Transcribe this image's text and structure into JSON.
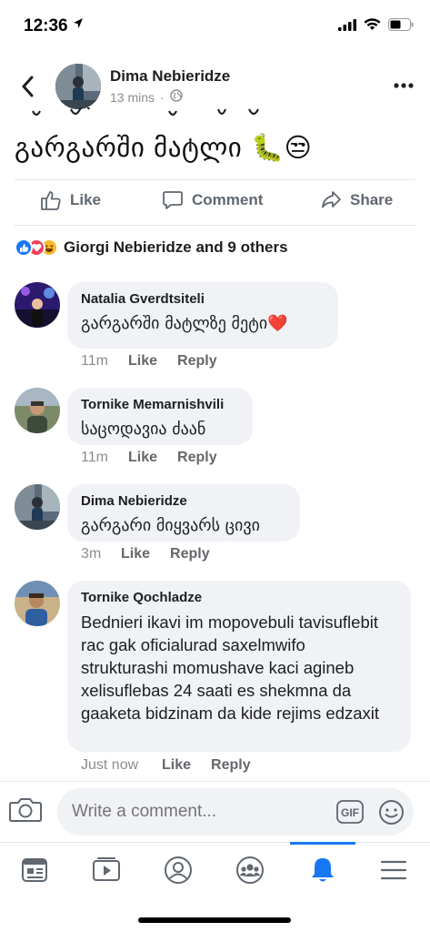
{
  "status_bar": {
    "time": "12:36"
  },
  "post": {
    "author": "Dima Nebieridze",
    "time": "13 mins",
    "text": "გარგარში მატლი 🐛😒"
  },
  "actions": {
    "like": "Like",
    "comment": "Comment",
    "share": "Share"
  },
  "reactions": {
    "summary": "Giorgi Nebieridze and 9 others"
  },
  "comments": [
    {
      "name": "Natalia Gverdtsiteli",
      "text": "გარგარში მატლზე მეტი❤️",
      "time": "11m",
      "like": "Like",
      "reply": "Reply"
    },
    {
      "name": "Tornike Memarnishvili",
      "text": "საცოდავია ძაან",
      "time": "11m",
      "like": "Like",
      "reply": "Reply"
    },
    {
      "name": "Dima Nebieridze",
      "text": "გარგარი მიყვარს ცივი",
      "time": "3m",
      "like": "Like",
      "reply": "Reply"
    },
    {
      "name": "Tornike Qochladze",
      "text": "Bednieri ikavi im mopovebuli tavisuflebit rac gak oficialurad saxelmwifo strukturashi momushave kaci agineb xelisuflebas 24 saati  es shekmna da gaaketa bidzinam da kide rejims edzaxit",
      "time": "Just now",
      "like": "Like",
      "reply": "Reply"
    }
  ],
  "composer": {
    "placeholder": "Write a comment...",
    "gif": "GIF"
  },
  "colors": {
    "accent": "#1877f2",
    "bubble": "#f0f2f5",
    "meta": "#65676b"
  },
  "tabs": [
    "news-feed-icon",
    "watch-icon",
    "profile-icon",
    "groups-icon",
    "notifications-icon",
    "menu-icon"
  ],
  "active_tab": "notifications-icon"
}
